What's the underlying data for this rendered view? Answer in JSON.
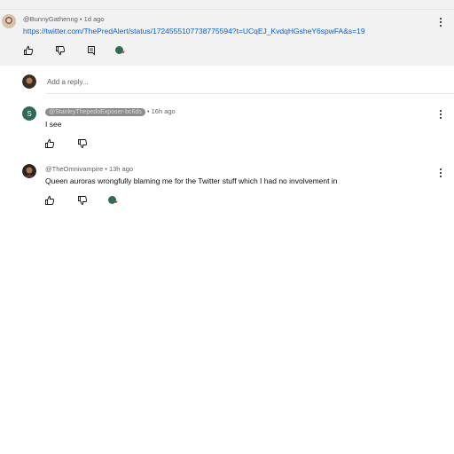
{
  "comment": {
    "author": "@BunnyGathenng",
    "separator": "•",
    "time": "1d ago",
    "link": "https://twitter.com/ThePredAlert/status/1724555107738775594?t=UCqEJ_KvdqHGsheY6spwFA&s=19"
  },
  "reply_box": {
    "placeholder": "Add a reply..."
  },
  "replies": [
    {
      "author": "@StanleyThepedoExposer-bc6ds",
      "separator": "•",
      "time": "16h ago",
      "text": "I see",
      "avatar_letter": "S"
    },
    {
      "author": "@TheOmnivampire",
      "separator": "•",
      "time": "13h ago",
      "text": "Queen auroras wrongfully blaming me for the Twitter stuff which I had no involvement in"
    }
  ],
  "colors": {
    "link": "#065fd4",
    "highlight_bg": "#f2f2f2",
    "avatar_s": "#2e6b57"
  },
  "icons": [
    "like-icon",
    "dislike-icon",
    "reply-icon",
    "creator-heart-icon",
    "more-vert-icon"
  ]
}
